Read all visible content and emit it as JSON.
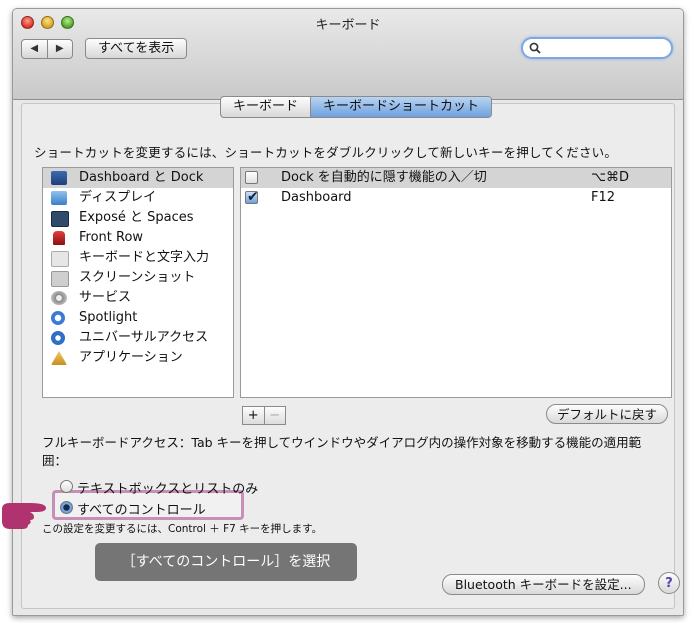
{
  "window": {
    "title": "キーボード",
    "nav_back": "◀",
    "nav_forward": "▶",
    "show_all": "すべてを表示",
    "search_placeholder": ""
  },
  "tabs": [
    {
      "label": "キーボード",
      "active": false
    },
    {
      "label": "キーボードショートカット",
      "active": true
    }
  ],
  "instruction": "ショートカットを変更するには、ショートカットをダブルクリックして新しいキーを押してください。",
  "categories": [
    {
      "label": "Dashboard と Dock",
      "icon": "dashboard-icon",
      "selected": true
    },
    {
      "label": "ディスプレイ",
      "icon": "display-icon",
      "selected": false
    },
    {
      "label": "Exposé と Spaces",
      "icon": "spaces-icon",
      "selected": false
    },
    {
      "label": "Front Row",
      "icon": "front-row-icon",
      "selected": false
    },
    {
      "label": "キーボードと文字入力",
      "icon": "keyboard-input-icon",
      "selected": false
    },
    {
      "label": "スクリーンショット",
      "icon": "screenshot-icon",
      "selected": false
    },
    {
      "label": "サービス",
      "icon": "gear-icon",
      "selected": false
    },
    {
      "label": "Spotlight",
      "icon": "spotlight-icon",
      "selected": false
    },
    {
      "label": "ユニバーサルアクセス",
      "icon": "universal-access-icon",
      "selected": false
    },
    {
      "label": "アプリケーション",
      "icon": "applications-icon",
      "selected": false
    }
  ],
  "shortcuts": [
    {
      "name": "Dock を自動的に隠す機能の入／切",
      "key": "⌥⌘D",
      "checked": false,
      "selected": true
    },
    {
      "name": "Dashboard",
      "key": "F12",
      "checked": true,
      "selected": false
    }
  ],
  "buttons": {
    "plus": "+",
    "minus": "−",
    "restore_defaults": "デフォルトに戻す",
    "bluetooth": "Bluetooth キーボードを設定...",
    "help": "?"
  },
  "full_keyboard_access": {
    "description": "フルキーボードアクセス：Tab キーを押してウインドウやダイアログ内の操作対象を移動する機能の適用範囲：",
    "options": [
      {
        "label": "テキストボックスとリストのみ",
        "selected": false
      },
      {
        "label": "すべてのコントロール",
        "selected": true
      }
    ],
    "note": "この設定を変更するには、Control ＋ F7 キーを押します。"
  },
  "callout": "［すべてのコントロール］を選択",
  "colors": {
    "selection_blue": "#6ea0de",
    "highlight_pink": "#c88fb6",
    "callout_bg": "#6f6f6f",
    "hand": "#b0336f"
  }
}
